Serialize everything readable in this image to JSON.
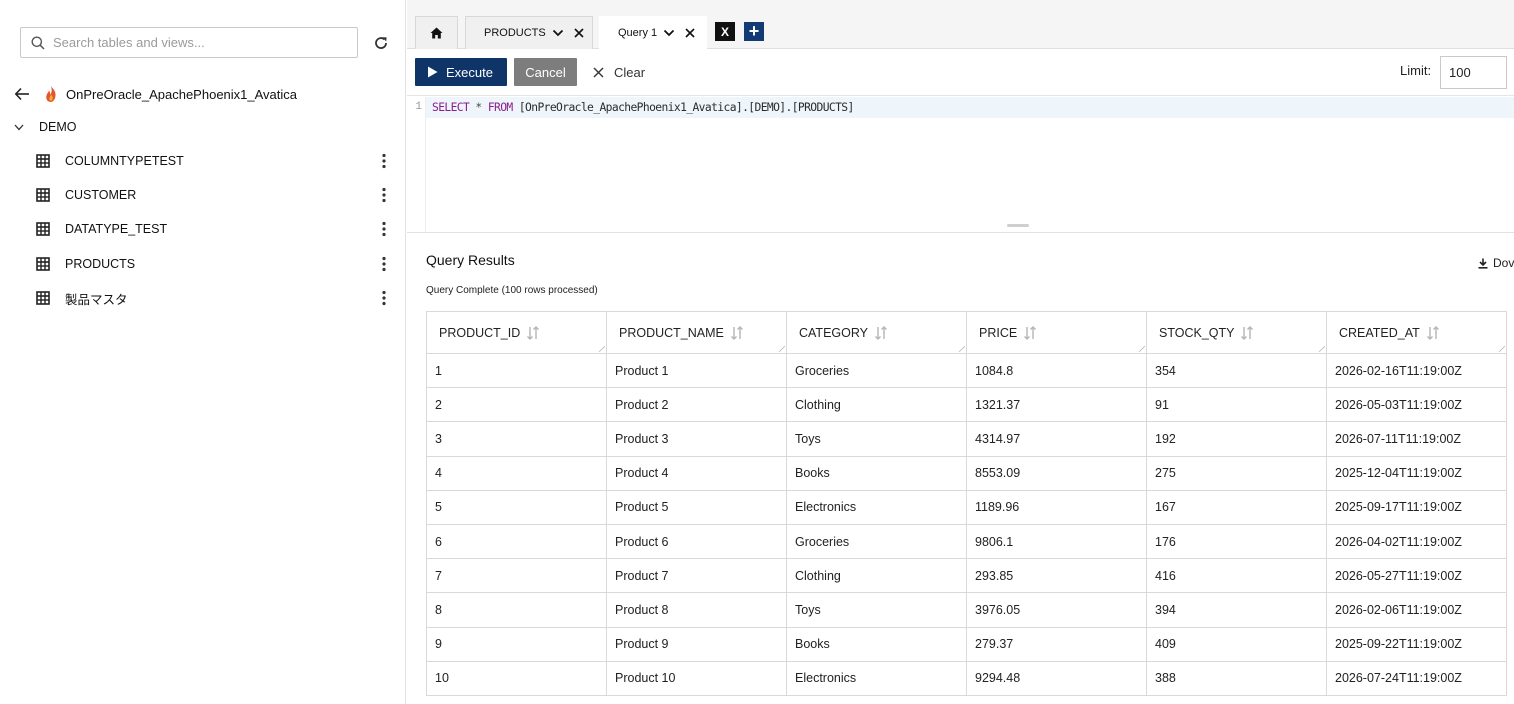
{
  "sidebar": {
    "search_placeholder": "Search tables and views...",
    "connection_name": "OnPreOracle_ApachePhoenix1_Avatica",
    "schema": "DEMO",
    "tables": [
      "COLUMNTYPETEST",
      "CUSTOMER",
      "DATATYPE_TEST",
      "PRODUCTS",
      "製品マスタ"
    ]
  },
  "tabs": [
    {
      "label": "PRODUCTS",
      "active": false
    },
    {
      "label": "Query 1",
      "active": true
    }
  ],
  "tab_buttons": {
    "close_all": "X",
    "add": "+"
  },
  "toolbar": {
    "execute_label": "Execute",
    "cancel_label": "Cancel",
    "clear_label": "Clear",
    "limit_label": "Limit:",
    "limit_value": "100"
  },
  "editor": {
    "line_number": "1",
    "keyword_select": "SELECT",
    "star": "*",
    "keyword_from": "FROM",
    "target": "[OnPreOracle_ApachePhoenix1_Avatica].[DEMO].[PRODUCTS]"
  },
  "results": {
    "title": "Query Results",
    "status": "Query Complete (100 rows processed)",
    "download_label": "Dov",
    "columns": [
      "PRODUCT_ID",
      "PRODUCT_NAME",
      "CATEGORY",
      "PRICE",
      "STOCK_QTY",
      "CREATED_AT"
    ],
    "rows": [
      [
        "1",
        "Product 1",
        "Groceries",
        "1084.8",
        "354",
        "2026-02-16T11:19:00Z"
      ],
      [
        "2",
        "Product 2",
        "Clothing",
        "1321.37",
        "91",
        "2026-05-03T11:19:00Z"
      ],
      [
        "3",
        "Product 3",
        "Toys",
        "4314.97",
        "192",
        "2026-07-11T11:19:00Z"
      ],
      [
        "4",
        "Product 4",
        "Books",
        "8553.09",
        "275",
        "2025-12-04T11:19:00Z"
      ],
      [
        "5",
        "Product 5",
        "Electronics",
        "1189.96",
        "167",
        "2025-09-17T11:19:00Z"
      ],
      [
        "6",
        "Product 6",
        "Groceries",
        "9806.1",
        "176",
        "2026-04-02T11:19:00Z"
      ],
      [
        "7",
        "Product 7",
        "Clothing",
        "293.85",
        "416",
        "2026-05-27T11:19:00Z"
      ],
      [
        "8",
        "Product 8",
        "Toys",
        "3976.05",
        "394",
        "2026-02-06T11:19:00Z"
      ],
      [
        "9",
        "Product 9",
        "Books",
        "279.37",
        "409",
        "2025-09-22T11:19:00Z"
      ],
      [
        "10",
        "Product 10",
        "Electronics",
        "9294.48",
        "388",
        "2026-07-24T11:19:00Z"
      ]
    ]
  },
  "colors": {
    "primary": "#0f3468",
    "cancel": "#7d7d7d",
    "add_tab": "#123a73",
    "sql_keyword": "#8b1c8b"
  }
}
